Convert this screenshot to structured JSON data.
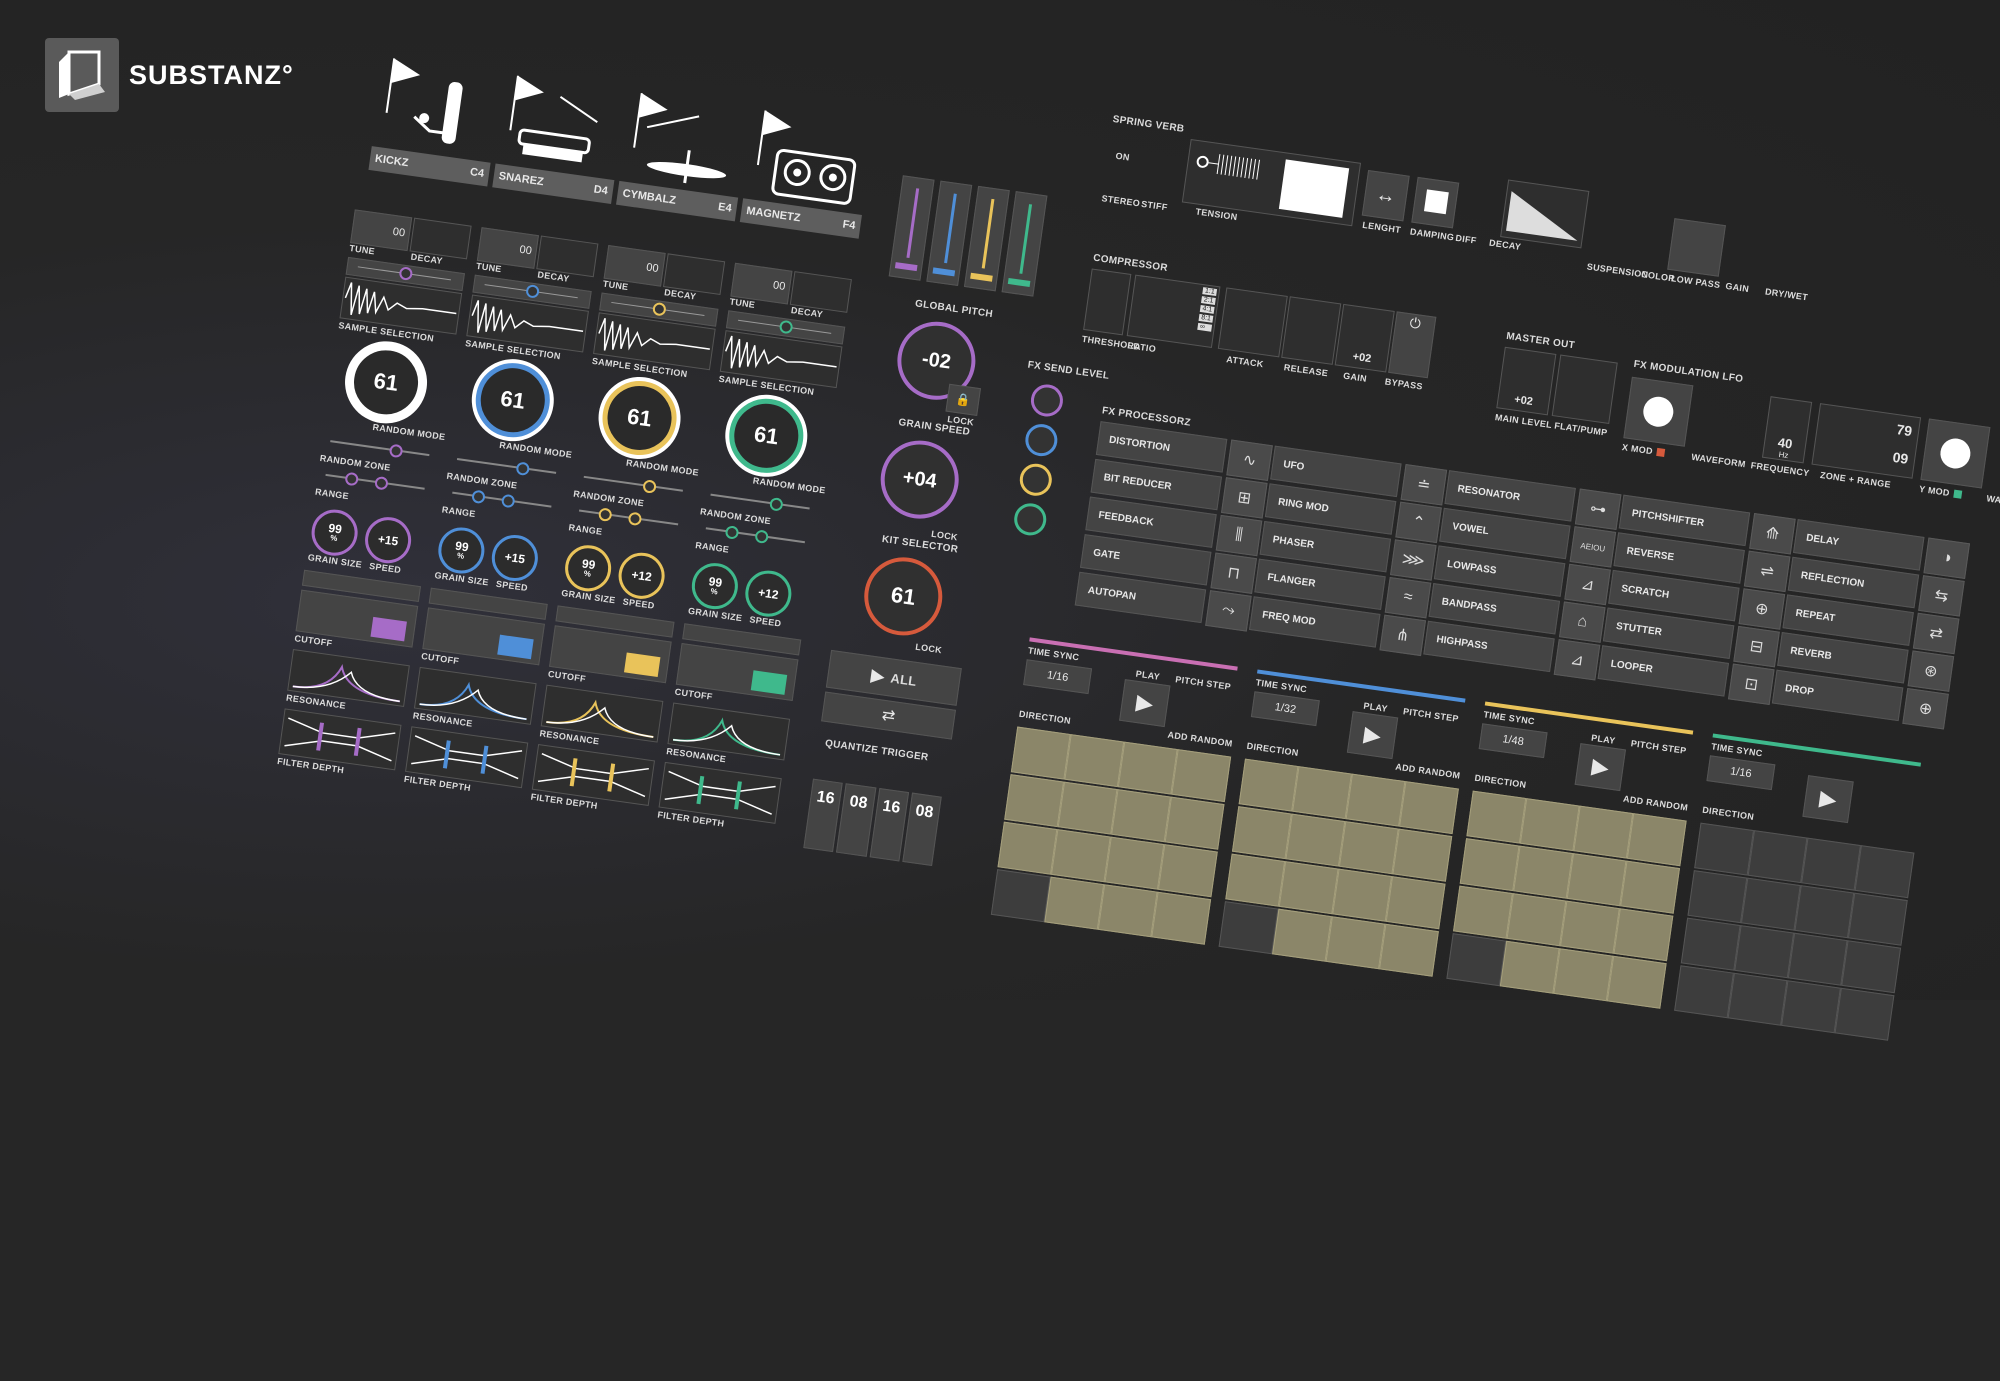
{
  "brand": {
    "name": "SUBSTANZ°"
  },
  "colors": {
    "purple": "#a66cc7",
    "blue": "#4f8fd8",
    "yellow": "#e9c35a",
    "green": "#3fb98c",
    "red": "#d65a3c",
    "pink": "#c96fb3"
  },
  "drums": [
    {
      "name": "KICKZ",
      "note": "C4",
      "color": "#a66cc7",
      "knob": "61",
      "grain": "99",
      "speed": "+15"
    },
    {
      "name": "SNAREZ",
      "note": "D4",
      "color": "#4f8fd8",
      "knob": "61",
      "grain": "99",
      "speed": "+15"
    },
    {
      "name": "CYMBALZ",
      "note": "E4",
      "color": "#e9c35a",
      "knob": "61",
      "grain": "99",
      "speed": "+12"
    },
    {
      "name": "MAGNETZ",
      "note": "F4",
      "color": "#3fb98c",
      "knob": "61",
      "grain": "99",
      "speed": "+12"
    }
  ],
  "labels": {
    "tune": "TUNE",
    "decay": "DECAY",
    "tune_val": "00",
    "sample_selection": "SAMPLE SELECTION",
    "random_mode": "RANDOM MODE",
    "random_zone": "RANDOM ZONE",
    "range": "RANGE",
    "grain_size": "GRAIN SIZE",
    "speed": "SPEED",
    "cutoff": "CUTOFF",
    "resonance": "RESONANCE",
    "filter_depth": "FILTER DEPTH",
    "grain_unit": "%"
  },
  "global": {
    "global_pitch": "GLOBAL PITCH",
    "global_pitch_val": "-02",
    "grain_speed": "GRAIN SPEED",
    "grain_speed_val": "+04",
    "lock": "LOCK",
    "kit_selector": "KIT SELECTOR",
    "kit_val": "61",
    "all": "ALL",
    "quantize": "QUANTIZE TRIGGER",
    "quantize_vals": [
      "16",
      "08",
      "16",
      "08"
    ]
  },
  "spring": {
    "title": "SPRING VERB",
    "on": "ON",
    "stereo": "STEREO",
    "stiff": "STIFF",
    "tension": "TENSION",
    "lenght": "LENGHT",
    "damping": "DAMPING",
    "diff": "DIFF",
    "decay": "DECAY",
    "suspension": "SUSPENSION",
    "color": "COLOR",
    "low_pass": "LOW PASS",
    "gain": "GAIN",
    "dry_wet": "DRY/WET"
  },
  "comp": {
    "title": "COMPRESSOR",
    "threshold": "THRESHOLD",
    "ratio": "RATIO",
    "ratios": [
      "1:1",
      "2:1",
      "4:1",
      "8:1"
    ],
    "ratio_inf": "∞",
    "attack": "ATTACK",
    "release": "RELEASE",
    "gain": "GAIN",
    "gain_val": "+02",
    "bypass": "BYPASS",
    "master": "MASTER OUT",
    "main_level": "MAIN LEVEL",
    "main_val": "+02",
    "flat": "FLAT/PUMP"
  },
  "lfo": {
    "title": "FX MODULATION LFO",
    "xmod": "X MOD",
    "waveform": "WAVEFORM",
    "frequency": "FREQUENCY",
    "freq_val": "40",
    "freq_unit": "Hz",
    "zone": "ZONE + RANGE",
    "zone_top": "79",
    "zone_bot": "09",
    "ymod": "Y MOD",
    "waveform2": "WAVEFORM"
  },
  "fx_send": "FX SEND LEVEL",
  "fx_proc": "FX PROCESSORZ",
  "fx_cols": [
    [
      "DISTORTION",
      "BIT REDUCER",
      "FEEDBACK",
      "GATE",
      "AUTOPAN"
    ],
    [
      "UFO",
      "RING MOD",
      "PHASER",
      "FLANGER",
      "FREQ MOD"
    ],
    [
      "RESONATOR",
      "VOWEL",
      "LOWPASS",
      "BANDPASS",
      "HIGHPASS"
    ],
    [
      "PITCHSHIFTER",
      "REVERSE",
      "SCRATCH",
      "STUTTER",
      "LOOPER"
    ],
    [
      "DELAY",
      "REFLECTION",
      "REPEAT",
      "REVERB",
      "DROP"
    ]
  ],
  "vowel_icon": "AEIOU",
  "seq": [
    {
      "time": "TIME SYNC",
      "rate": "1/16",
      "play": "PLAY",
      "pitch": "PITCH STEP",
      "dir": "DIRECTION",
      "add": "ADD RANDOM",
      "color": "#c96fb3"
    },
    {
      "time": "TIME SYNC",
      "rate": "1/32",
      "play": "PLAY",
      "pitch": "PITCH STEP",
      "dir": "DIRECTION",
      "add": "ADD RANDOM",
      "color": "#4f8fd8"
    },
    {
      "time": "TIME SYNC",
      "rate": "1/48",
      "play": "PLAY",
      "pitch": "PITCH STEP",
      "dir": "DIRECTION",
      "add": "ADD RANDOM",
      "color": "#e9c35a"
    },
    {
      "time": "TIME SYNC",
      "rate": "1/16",
      "play": "",
      "pitch": "",
      "dir": "DIRECTION",
      "add": "",
      "color": "#3fb98c"
    }
  ]
}
